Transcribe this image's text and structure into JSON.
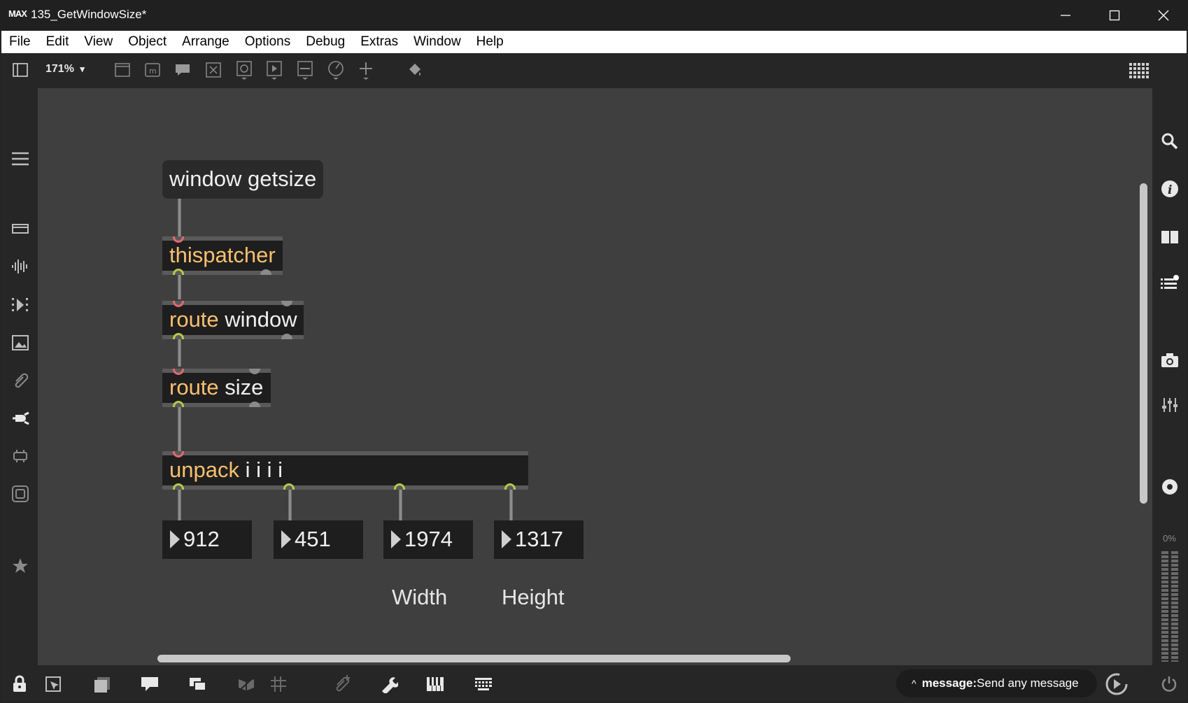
{
  "window": {
    "logo_text": "MAX",
    "title": "135_GetWindowSize*",
    "controls": [
      "minimize",
      "maximize",
      "close"
    ]
  },
  "menu": [
    "File",
    "Edit",
    "View",
    "Object",
    "Arrange",
    "Options",
    "Debug",
    "Extras",
    "Window",
    "Help"
  ],
  "toolbar": {
    "zoom": "171%",
    "zoom_caret": "▾"
  },
  "patch": {
    "message_box": "window getsize",
    "thispatcher": "thispatcher",
    "route1_kw": "route",
    "route1_arg": " window",
    "route2_kw": "route",
    "route2_arg": " size",
    "unpack_kw": "unpack",
    "unpack_arg": " i i i i",
    "numbers": [
      "912",
      "451",
      "1974",
      "1317"
    ],
    "label_width": "Width",
    "label_height": "Height"
  },
  "rightbar": {
    "meter_label": "0%"
  },
  "statusbar": {
    "caret": "^",
    "message_label": "message:",
    "message_text": " Send any message"
  },
  "colors": {
    "canvas": "#3f3f3f",
    "object_bg": "#1e1e1e",
    "keyword": "#f7c070",
    "inlet": "#e06a70",
    "outlet": "#b8c84a"
  }
}
